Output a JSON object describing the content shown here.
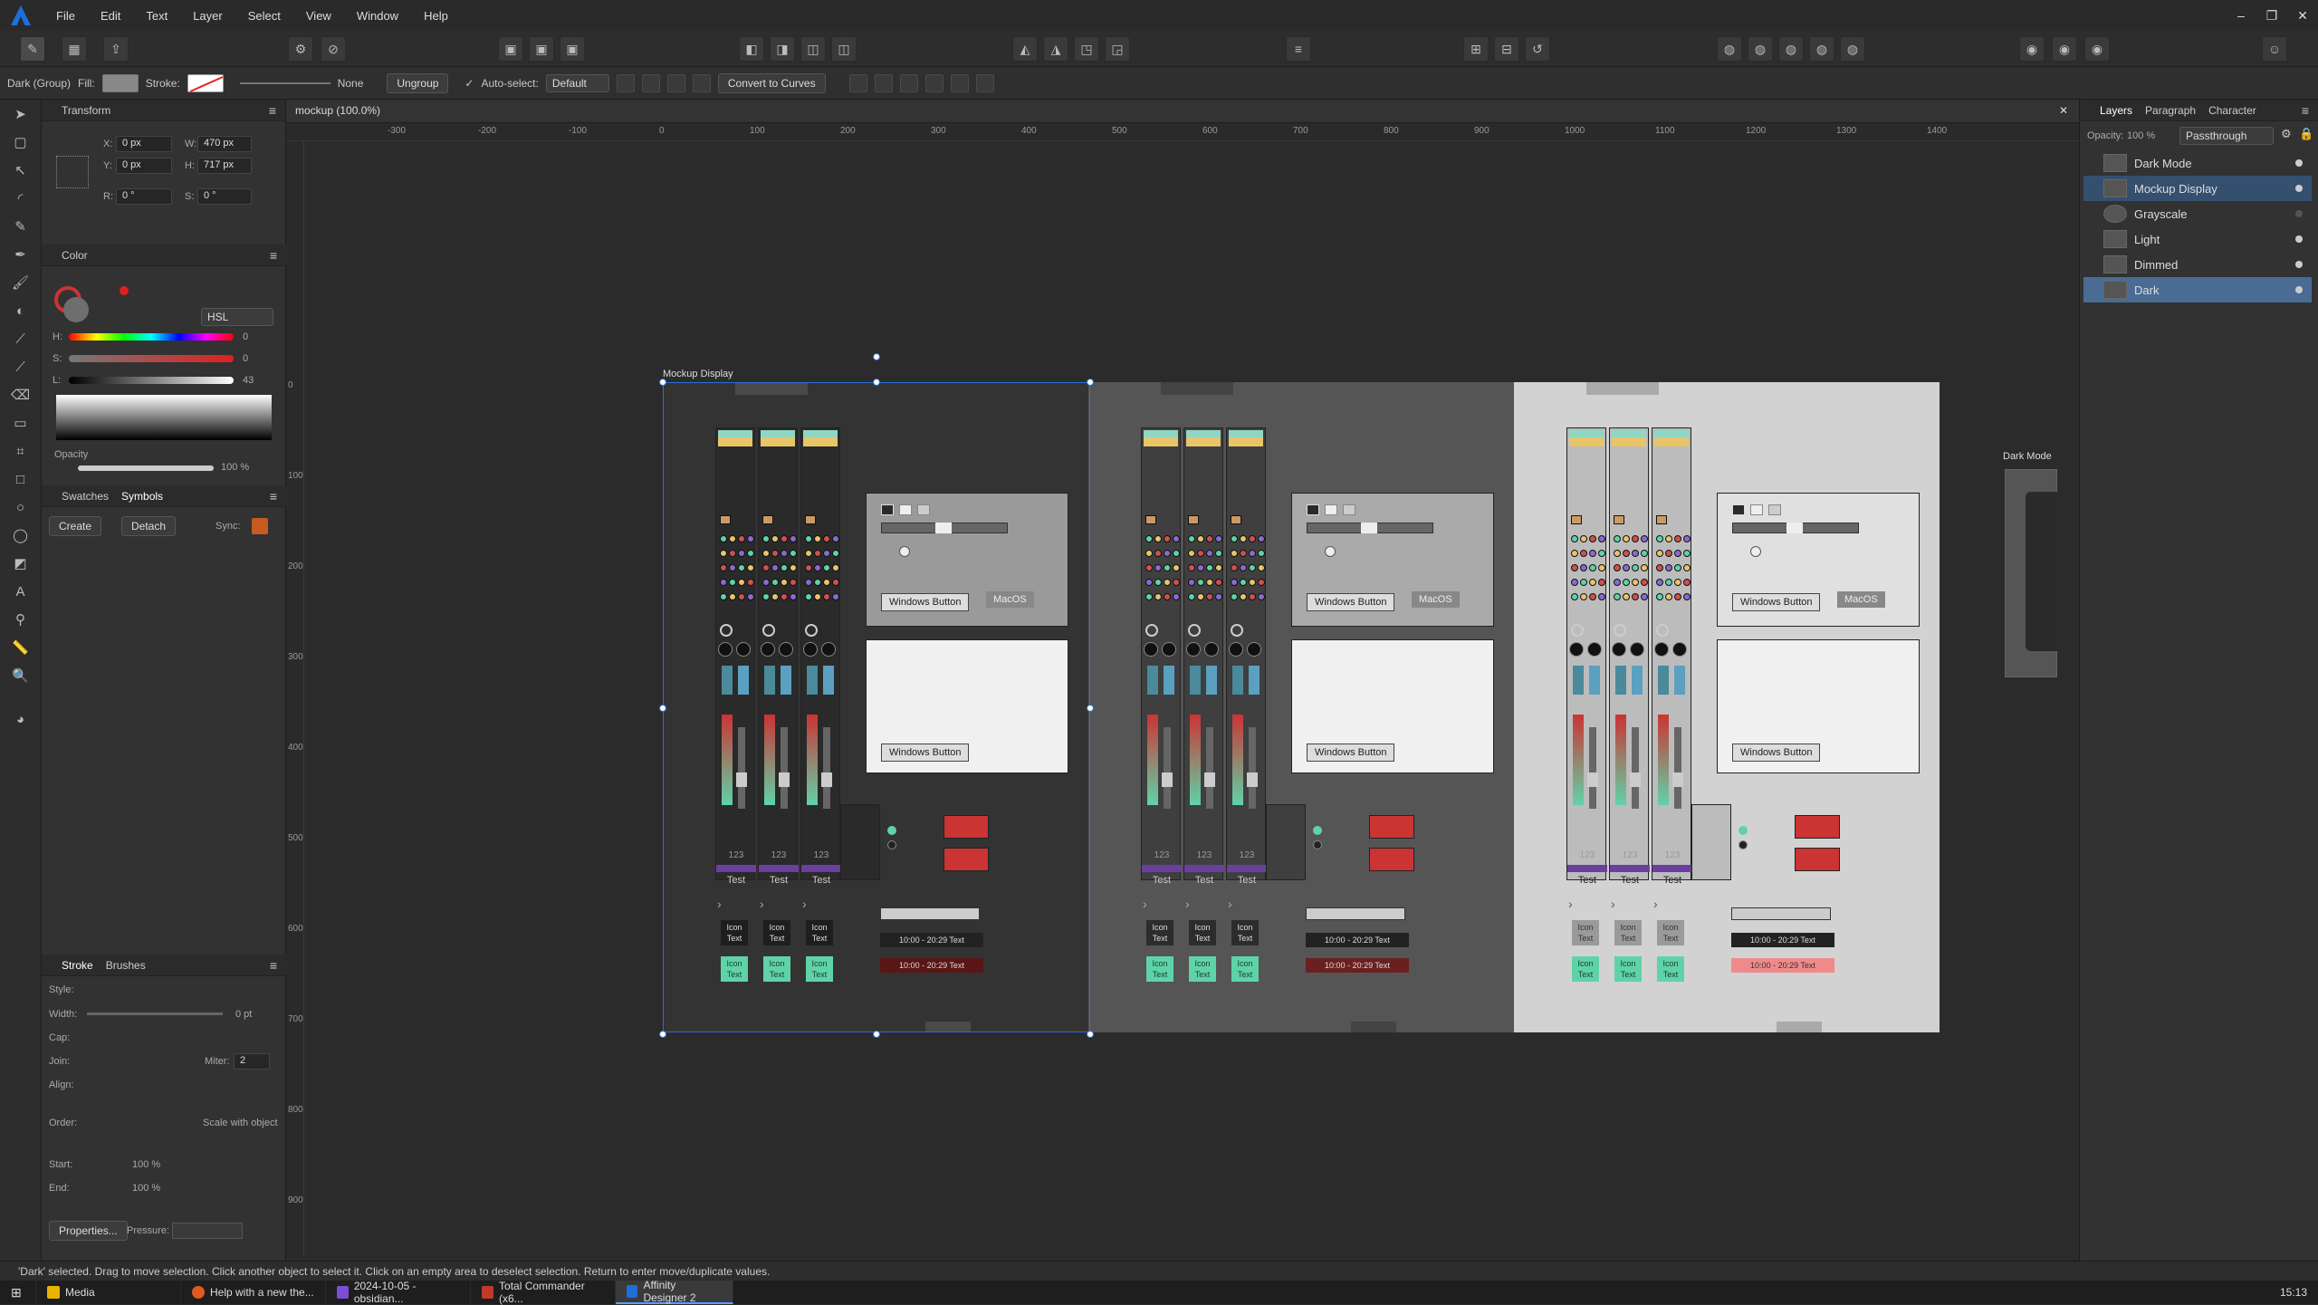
{
  "menubar": {
    "items": [
      "File",
      "Edit",
      "Text",
      "Layer",
      "Select",
      "View",
      "Window",
      "Help"
    ],
    "window_controls": [
      "–",
      "❐",
      "✕"
    ]
  },
  "context": {
    "selection": "Dark (Group)",
    "fill_label": "Fill:",
    "stroke_label": "Stroke:",
    "stroke_style": "None",
    "ungroup": "Ungroup",
    "auto_select": "Auto-select:",
    "auto_select_value": "Default",
    "convert": "Convert to Curves"
  },
  "transform": {
    "title": "Transform",
    "x": "0 px",
    "y": "0 px",
    "w": "470 px",
    "h": "717 px",
    "r": "0 °",
    "s": "0 °",
    "labels": {
      "x": "X:",
      "y": "Y:",
      "w": "W:",
      "h": "H:",
      "r": "R:",
      "s": "S:"
    }
  },
  "color": {
    "title": "Color",
    "mode": "HSL",
    "h": "0",
    "s": "0",
    "l": "43",
    "opacity_label": "Opacity",
    "opacity": "100 %",
    "labels": {
      "h": "H:",
      "s": "S:",
      "l": "L:"
    }
  },
  "symbols": {
    "tabs": [
      "Swatches",
      "Symbols"
    ],
    "create": "Create",
    "detach": "Detach",
    "sync": "Sync:"
  },
  "stroke": {
    "tabs": [
      "Stroke",
      "Brushes"
    ],
    "style": "Style:",
    "width": "Width:",
    "width_value": "0 pt",
    "cap": "Cap:",
    "join": "Join:",
    "miter": "Miter:",
    "miter_value": "2",
    "align": "Align:",
    "order": "Order:",
    "scale": "Scale with object",
    "start": "Start:",
    "end": "End:",
    "start_pct": "100 %",
    "end_pct": "100 %",
    "properties": "Properties...",
    "pressure": "Pressure:"
  },
  "document": {
    "tab": "mockup (100.0%)",
    "artboard_label": "Mockup Display",
    "side_label": "Dark Mode"
  },
  "ruler": {
    "top": [
      "-300",
      "-200",
      "-100",
      "0",
      "100",
      "200",
      "300",
      "400",
      "500",
      "600",
      "700",
      "800",
      "900",
      "1000",
      "1100",
      "1200",
      "1300",
      "1400"
    ],
    "left": [
      "0",
      "100",
      "200",
      "300",
      "400",
      "500",
      "600",
      "700",
      "800",
      "900"
    ]
  },
  "layers": {
    "tabs": [
      "Layers",
      "Paragraph",
      "Character"
    ],
    "opacity_label": "Opacity:",
    "opacity": "100 %",
    "blend": "Passthrough",
    "items": [
      "Dark Mode",
      "Mockup Display",
      "Grayscale",
      "Light",
      "Dimmed",
      "Dark"
    ]
  },
  "mockup": {
    "strip_label": "Test",
    "strip_number": "123",
    "icon_text": "Icon Text",
    "windows_button": "Windows Button",
    "macos_button": "MacOS",
    "time_range": "10:00 - 20:29",
    "time_text": "Text"
  },
  "status": "'Dark' selected. Drag to move selection. Click another object to select it. Click on an empty area to deselect selection. Return to enter move/duplicate values.",
  "taskbar": {
    "items": [
      "Media",
      "Help with a new the...",
      "2024-10-05 - obsidian...",
      "Total Commander (x6...",
      "Affinity Designer 2"
    ],
    "clock": "15:13"
  },
  "colors": {
    "accent": "#5aa0ff",
    "selection": "#2a6fd9",
    "mint": "#5fd3a8",
    "teal": "#8fd6c5",
    "yellow": "#e8c56a",
    "purple": "#6a3fa0",
    "red": "#c0302f"
  }
}
